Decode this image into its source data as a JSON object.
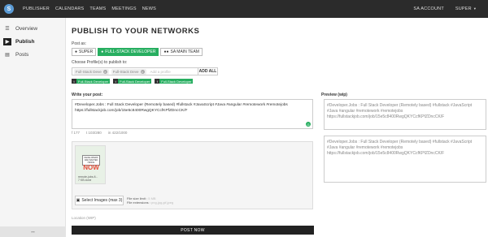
{
  "topbar": {
    "logo": "S",
    "nav": [
      "PUBLISHER",
      "CALENDARS",
      "TEAMS",
      "MEETINGS",
      "NEWS"
    ],
    "account": "SA ACCOUNT",
    "user": "SUPER"
  },
  "sidebar": {
    "items": [
      {
        "label": "Overview",
        "icon": "overview-icon"
      },
      {
        "label": "Publish",
        "icon": "publish-icon"
      },
      {
        "label": "Posts",
        "icon": "posts-icon"
      }
    ],
    "collapse": "↔"
  },
  "page": {
    "title": "PUBLISH TO YOUR NETWORKS",
    "post_as_label": "Post as:",
    "post_as": [
      {
        "label": "SUPER",
        "icon": "user-icon"
      },
      {
        "label": "FULL-STACK DEVELOPER",
        "icon": "user-icon"
      },
      {
        "label": "SA MAIN TEAM",
        "icon": "team-icon"
      }
    ],
    "choose_label": "Choose Profile(s) to publish to:",
    "selected_profiles": [
      "Full-Stack Deve",
      "Full-Stack Deve"
    ],
    "profile_placeholder": "Add a profile",
    "add_all": "ADD ALL",
    "chips": [
      "Full-Stack Developer",
      "Full-Stack Developer",
      "Full-Stack Developer"
    ],
    "write_label": "Write your post:",
    "post_text": "#Developer.Jobs : Full Stack Developer (Remotely based) #fullstack #JavaScript #Java #angular #remotework #remotejobs  https://fullstackjob.com/job/15e5c8400RwgQKYCcfKPfZDncCK/F",
    "counts": [
      "177",
      "103/280",
      "422/1000"
    ],
    "image_caption": "remote-jobs-fi...",
    "image_caption2": "7 KB done",
    "sign_text": "DEVELOPERS ARE WANTED HIRING",
    "now_text": "NOW",
    "select_images": "Select Images (max 3)",
    "file_size_label": "File size limit :",
    "file_size_value": "5 MB",
    "file_ext_label": "File extensions :",
    "file_ext_value": "png,jpg,gif,jpeg",
    "location_label": "Location (WIP)",
    "post_now": "POST NOW",
    "preview_label": "Preview (wip)",
    "preview1": "#Developer.Jobs : Full Stack Developer (Remotely based) #fullstack #JavaScript #Java #angular #remotework #remotejobs https://fullstackjob.com/job/15e5c8400RwgQKYCcfKPfZDncCK/F",
    "preview2": "#Developer.Jobs : Full Stack Developer (Remotely based) #fullstack #JavaScript #Java #angular #remotework #remotejobs https://fullstackjob.com/job/15e5c8400RwgQKYCcfKPfZDncCK/F"
  },
  "colors": {
    "accent": "#27ae60",
    "topbar": "#2b2b2b",
    "button_dark": "#222222"
  }
}
